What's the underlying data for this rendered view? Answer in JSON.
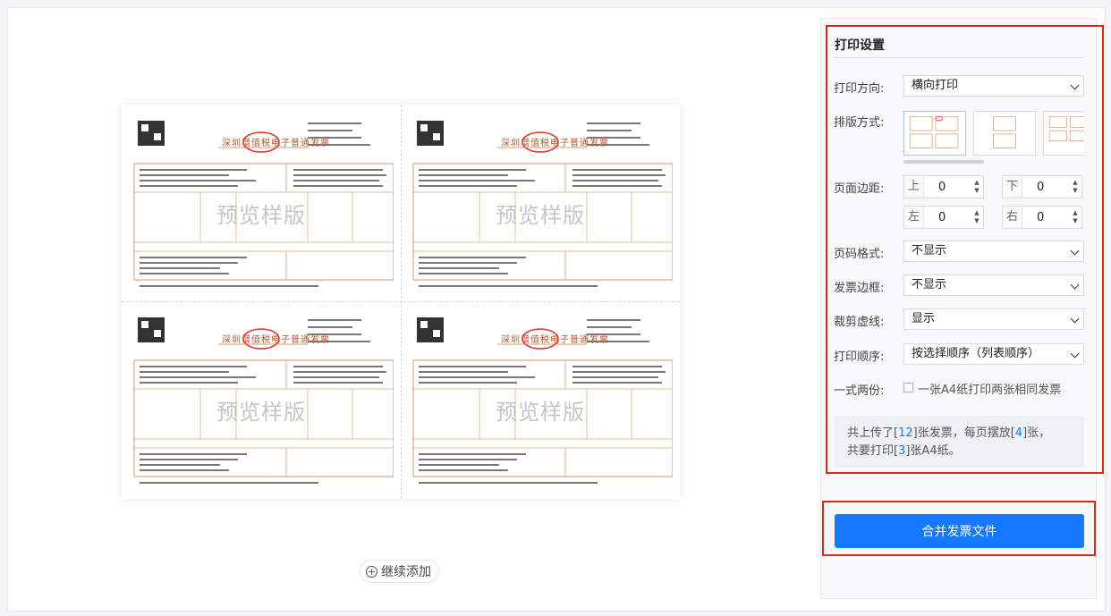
{
  "preview": {
    "watermark": "预览样版",
    "invoice_title": "深圳增值税电子普通发票",
    "add_more_label": "继续添加"
  },
  "settings": {
    "title": "打印设置",
    "orientation_label": "打印方向:",
    "orientation_value": "横向打印",
    "layout_label": "排版方式:",
    "margin_label": "页面边距:",
    "margin_top_label": "上",
    "margin_top_value": "0",
    "margin_bottom_label": "下",
    "margin_bottom_value": "0",
    "margin_left_label": "左",
    "margin_left_value": "0",
    "margin_right_label": "右",
    "margin_right_value": "0",
    "page_number_label": "页码格式:",
    "page_number_value": "不显示",
    "border_label": "发票边框:",
    "border_value": "不显示",
    "cut_line_label": "裁剪虚线:",
    "cut_line_value": "显示",
    "order_label": "打印顺序:",
    "order_value": "按选择顺序（列表顺序）",
    "duplicate_label": "一式两份:",
    "duplicate_option": "一张A4纸打印两张相同发票",
    "summary": {
      "p1": "共上传了[",
      "n1": "12",
      "p2": "]张发票，每页摆放[",
      "n2": "4",
      "p3": "]张，",
      "p4": "共要打印[",
      "n3": "3",
      "p5": "]张A4纸。"
    },
    "merge_button": "合并发票文件"
  },
  "colors": {
    "accent": "#1677ff",
    "highlight_border": "#e1251b",
    "invoice_line": "#c77b4e"
  }
}
